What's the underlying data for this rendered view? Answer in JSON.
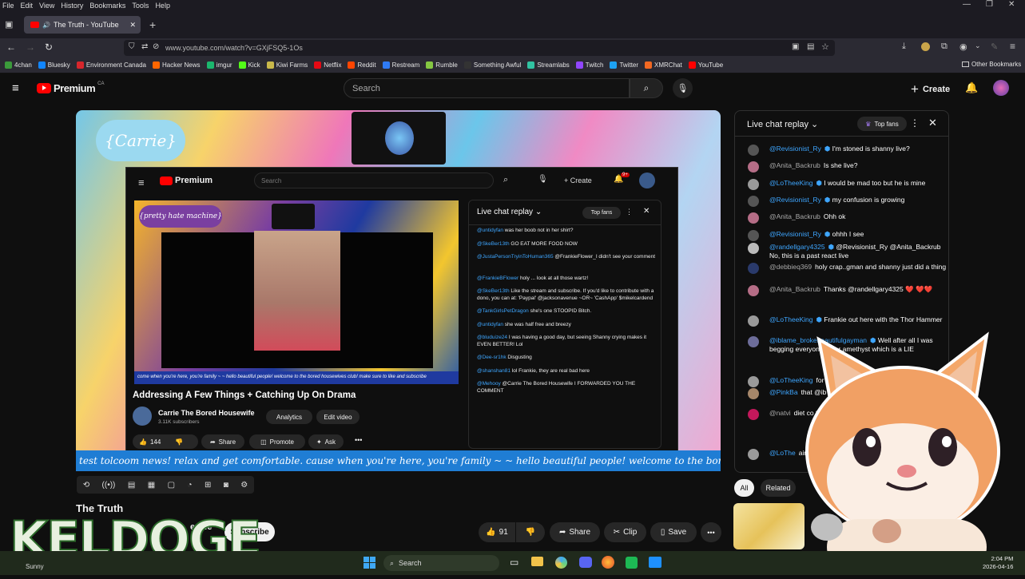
{
  "menubar": {
    "items": [
      "File",
      "Edit",
      "View",
      "History",
      "Bookmarks",
      "Tools",
      "Help"
    ]
  },
  "browser": {
    "tab_title": "The Truth - YouTube",
    "url": "www.youtube.com/watch?v=GXjFSQ5-1Os",
    "bookmarks": [
      {
        "label": "4chan",
        "color": "#3b9a3b"
      },
      {
        "label": "Bluesky",
        "color": "#1185fe"
      },
      {
        "label": "Environment Canada",
        "color": "#d7262c"
      },
      {
        "label": "Hacker News",
        "color": "#ff6600"
      },
      {
        "label": "imgur",
        "color": "#1bb76e"
      },
      {
        "label": "Kick",
        "color": "#53fc18"
      },
      {
        "label": "Kiwi Farms",
        "color": "#c9b84a"
      },
      {
        "label": "Netflix",
        "color": "#e50914"
      },
      {
        "label": "Reddit",
        "color": "#ff4500"
      },
      {
        "label": "Restream",
        "color": "#2f7bf5"
      },
      {
        "label": "Rumble",
        "color": "#85c742"
      },
      {
        "label": "Something Awful",
        "color": "#333333"
      },
      {
        "label": "Streamlabs",
        "color": "#31c3a2"
      },
      {
        "label": "Twitch",
        "color": "#9146ff"
      },
      {
        "label": "Twitter",
        "color": "#1da1f2"
      },
      {
        "label": "XMRChat",
        "color": "#f26822"
      },
      {
        "label": "YouTube",
        "color": "#ff0000"
      }
    ],
    "other_bookmarks": "Other Bookmarks"
  },
  "youtube": {
    "logo": "Premium",
    "region": "CA",
    "search_placeholder": "Search",
    "create": "Create",
    "video_title": "The Truth",
    "channel_partial": "ewife",
    "subscribe": "Subscribe",
    "likes": "91",
    "share": "Share",
    "clip": "Clip",
    "save": "Save",
    "tabs": {
      "all": "All",
      "related": "Related"
    }
  },
  "stream_overlay": {
    "name_tag": "{Carrie}",
    "ticker": "test tolcoom news! relax and get comfortable. cause when you're here, you're family ~  ~ hello beautiful people! welcome to the bored h"
  },
  "inner_page": {
    "logo": "Premium",
    "search": "Search",
    "create": "Create",
    "notif_count": "9+",
    "video_title": "Addressing A Few Things + Catching Up On Drama",
    "channel": "Carrie The Bored Housewife",
    "subs": "3.11K subscribers",
    "analytics": "Analytics",
    "edit": "Edit video",
    "likes": "144",
    "share": "Share",
    "promote": "Promote",
    "ask": "Ask",
    "inner_overlay_tag": "{pretty hate machine}",
    "inner_ticker": "come when you're here, you're family ~  ~ hello beautiful people! welcome to the bored housewives club! make sure to like and subscribe",
    "chat_header": "Live chat replay",
    "top_fans": "Top fans",
    "messages": [
      {
        "name": "@untidyfan",
        "text": "was her boob not in her shirt?"
      },
      {
        "name": "@SkeBer13th",
        "text": "GO EAT MORE FOOD NOW"
      },
      {
        "name": "@JustaPersonTryinToHuman365",
        "text": "@FrankieFlower_I didn't see your comment"
      },
      {
        "name": "@FrankieBFlower",
        "text": "holy ... look at all those wartz!"
      },
      {
        "name": "@SkeBer13th",
        "text": "Like the stream and subscribe. If you'd like to contribute with a dono, you can at: 'Paypal' @jacksonavenue ~OR~ 'CashApp' $mikelcardend"
      },
      {
        "name": "@TankGirlsPetDragon",
        "text": "she's one STOOPID Bitch."
      },
      {
        "name": "@untidyfan",
        "text": "she was half free and breezy"
      },
      {
        "name": "@bluduize24",
        "text": "I was having a good day, but seeing Shanny crying makes it EVEN BETTER! Lol"
      },
      {
        "name": "@Dee-sr1hk",
        "text": "Disgusting"
      },
      {
        "name": "@shanshan81",
        "text": "lol Frankie, they are real bad here"
      },
      {
        "name": "@Mehooy",
        "text": "@Carrie The Bored Housewife I FORWARDED YOU THE COMMENT"
      }
    ]
  },
  "live_chat": {
    "header": "Live chat replay",
    "top_fans": "Top fans",
    "messages": [
      {
        "name": "@Revisionist_Ry",
        "blue": true,
        "verified": true,
        "text": "I'm stoned is shanny live?",
        "avatar": "#555"
      },
      {
        "name": "@Anita_Backrub",
        "blue": false,
        "verified": false,
        "text": "Is she live?",
        "avatar": "#b56d86"
      },
      {
        "name": "@LoTheeKing",
        "blue": true,
        "verified": true,
        "text": "I would be mad too but he is mine",
        "avatar": "#9a9a9a"
      },
      {
        "name": "@Revisionist_Ry",
        "blue": true,
        "verified": true,
        "text": "my confusion is growing",
        "avatar": "#555"
      },
      {
        "name": "@Anita_Backrub",
        "blue": false,
        "verified": false,
        "text": "Ohh ok",
        "avatar": "#b56d86"
      },
      {
        "name": "@Revisionist_Ry",
        "blue": true,
        "verified": true,
        "text": "ohhh I see",
        "avatar": "#555"
      },
      {
        "name": "@randellgary4325",
        "blue": true,
        "verified": true,
        "text": "@Revisionist_Ry @Anita_Backrub No, this is a past react live",
        "avatar": "#bbb"
      },
      {
        "name": "@debbieq369",
        "blue": false,
        "verified": false,
        "text": "holy crap..gman and shanny just did a thing",
        "avatar": "#2a3a6b"
      },
      {
        "name": "@Anita_Backrub",
        "blue": false,
        "verified": false,
        "text": "Thanks @randellgary4325 ❤️ ❤️❤️",
        "avatar": "#b56d86"
      },
      {
        "name": "@LoTheeKing",
        "blue": true,
        "verified": true,
        "text": "Frankie out here with the Thor Hammer",
        "avatar": "#9a9a9a"
      },
      {
        "name": "@iblame_brokebeautifulgayman",
        "blue": true,
        "verified": true,
        "text": "Well after all I was begging everyone ... for amethyst which is a LIE",
        "avatar": "#6d6d9a"
      },
      {
        "name": "@LoTheeKing",
        "blue": true,
        "verified": false,
        "text": "for a bus p",
        "avatar": "#9a9a9a"
      },
      {
        "name": "@PinkBa",
        "blue": true,
        "verified": false,
        "text": "that @ib",
        "avatar": "#a6876a"
      },
      {
        "name": "@natvi",
        "blue": false,
        "verified": false,
        "text": "diet co this but you'll ge",
        "avatar": "#c2185b"
      },
      {
        "name": "@LoThe",
        "blue": true,
        "verified": false,
        "text": "aint been",
        "avatar": "#9a9a9a"
      }
    ]
  },
  "watermark": "KELDOGE",
  "taskbar": {
    "weather": "Sunny",
    "search": "Search",
    "time": "2:04 PM",
    "date": "2026-04-16"
  },
  "colors": {
    "yt_red": "#ff0000",
    "link_blue": "#3ea6ff",
    "ticker_blue": "#1f7dd4"
  }
}
